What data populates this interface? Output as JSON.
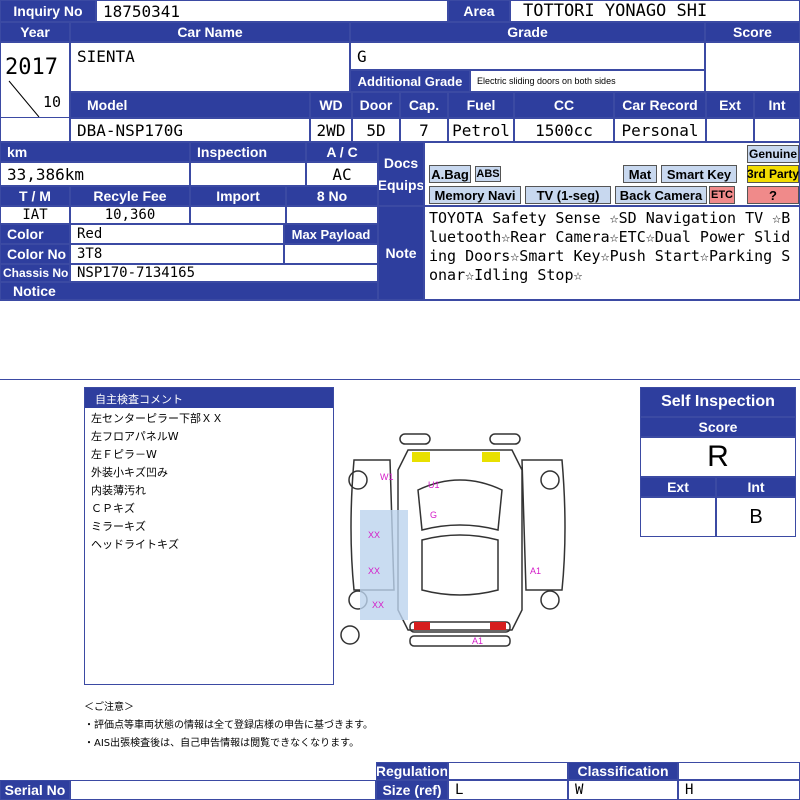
{
  "header": {
    "inquiry_label": "Inquiry No",
    "inquiry_no": "18750341",
    "area_label": "Area",
    "area": "TOTTORI YONAGO SHI",
    "year_label": "Year",
    "year": "2017",
    "month": "10",
    "carname_label": "Car Name",
    "car_name": "SIENTA",
    "grade_label": "Grade",
    "grade": "G",
    "addgrade_label": "Additional Grade",
    "add_grade": "Electric sliding doors on both sides",
    "score_label": "Score",
    "score": ""
  },
  "specs": {
    "model_label": "Model",
    "model": "DBA-NSP170G",
    "wd_label": "WD",
    "wd": "2WD",
    "door_label": "Door",
    "door": "5D",
    "cap_label": "Cap.",
    "cap": "7",
    "fuel_label": "Fuel",
    "fuel": "Petrol",
    "cc_label": "CC",
    "cc": "1500cc",
    "record_label": "Car Record",
    "record": "Personal",
    "ext_label": "Ext",
    "ext": "",
    "int_label": "Int",
    "int": ""
  },
  "details": {
    "km_label": "km",
    "km": "33,386km",
    "insp_label": "Inspection",
    "insp": "",
    "ac_label": "A / C",
    "ac": "AC",
    "tm_label": "T / M",
    "tm": "IAT",
    "recycle_label": "Recyle Fee",
    "recycle": "10,360",
    "import_label": "Import",
    "import": "",
    "eightno_label": "8 No",
    "eightno": "",
    "color_label": "Color",
    "color": "Red",
    "maxpayload_label": "Max Payload",
    "maxpayload": "",
    "colorno_label": "Color No",
    "colorno": "3T8",
    "chassis_label": "Chassis No",
    "chassis": "NSP170-7134165",
    "notice_label": "Notice",
    "notice": "",
    "docs_label": "Docs",
    "equips_label": "Equips",
    "note_label": "Note",
    "note": "TOYOTA Safety Sense ☆SD Navigation TV ☆Bluetooth☆Rear Camera☆ETC☆Dual Power Sliding Doors☆Smart Key☆Push Start☆Parking Sonar☆Idling Stop☆"
  },
  "equipment": {
    "abag": "A.Bag",
    "abs": "ABS",
    "mat": "Mat",
    "smartkey": "Smart Key",
    "genuine": "Genuine",
    "thirdparty": "3rd Party",
    "question": "?",
    "nav": "Memory Navi",
    "tv": "TV (1-seg)",
    "backcam": "Back Camera",
    "etc": "ETC"
  },
  "comments": {
    "title": "自主検査コメント",
    "lines": [
      "左センターピラー下部ＸＸ",
      "左フロアパネルW",
      "左Ｆピラ－W",
      "外装小キズ凹み",
      "内装薄汚れ",
      "ＣＰキズ",
      "ミラーキズ",
      "ヘッドライトキズ"
    ]
  },
  "diagram": {
    "marks": [
      "W1",
      "U1",
      "G",
      "XX",
      "A1",
      "XX",
      "XX",
      "A1"
    ]
  },
  "self_inspection": {
    "title": "Self Inspection",
    "score_label": "Score",
    "score": "R",
    "ext_label": "Ext",
    "int_label": "Int",
    "ext": "",
    "int": "B"
  },
  "notes": {
    "title": "＜ご注意＞",
    "line1": "・評価点等車両状態の情報は全て登録店様の申告に基づきます。",
    "line2": "・AIS出張検査後は、自己申告情報は閲覧できなくなります。"
  },
  "footer": {
    "serial_label": "Serial No",
    "serial": "",
    "regulation_label": "Regulation",
    "size_label": "Size (ref)",
    "classification_label": "Classification",
    "size_l": "L",
    "size_w": "W",
    "size_h": "H"
  },
  "colors": {
    "header_bg": "#2e3e9e",
    "equip_on": "#c8d8ef",
    "third_party": "#f2dc00",
    "etc": "#f08a8a"
  }
}
